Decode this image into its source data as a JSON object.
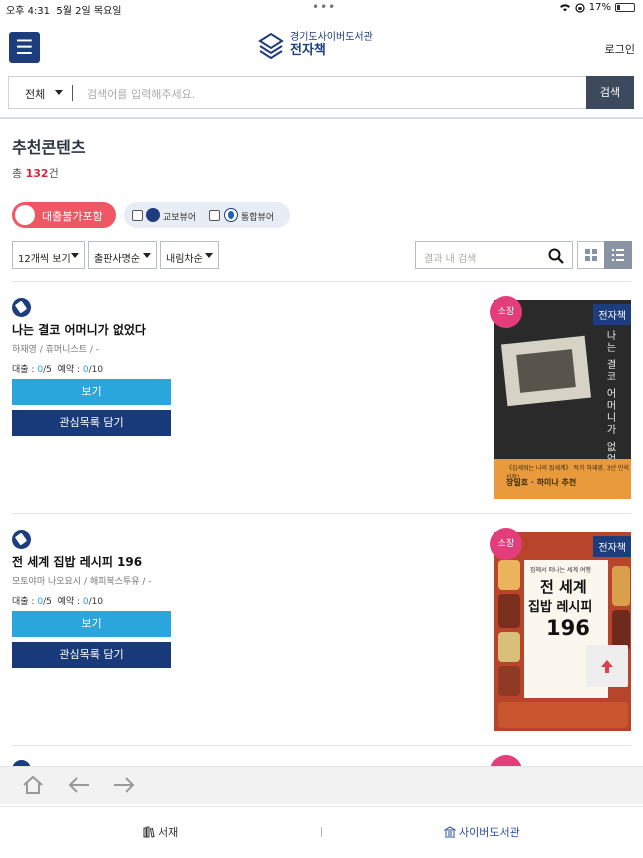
{
  "status": {
    "time": "오후 4:31",
    "date": "5월 2일 목요일",
    "dots": "•••",
    "battery": "17%"
  },
  "header": {
    "logo_line1": "경기도사이버도서관",
    "logo_line2": "전자책",
    "login": "로그인",
    "menu_icon": "☰"
  },
  "search": {
    "scope": "전체",
    "placeholder": "검색어를 입력해주세요.",
    "button": "검색"
  },
  "page": {
    "title": "추천콘텐츠",
    "total_prefix": "총 ",
    "total_count": "132",
    "total_suffix": "건"
  },
  "filters": {
    "toggle_label": "대출불가포함",
    "viewers": [
      {
        "label": "교보뷰어"
      },
      {
        "label": "통합뷰어"
      }
    ],
    "selects": [
      {
        "label": "12개씩 보기"
      },
      {
        "label": "출판사명순"
      },
      {
        "label": "내림차순"
      }
    ],
    "result_search_placeholder": "결과 내 검색"
  },
  "books": [
    {
      "title": "나는 결코 어머니가 없었다",
      "author": "하재영 / 휴머니스트 / -",
      "loan_label": "대출 : ",
      "loan_now": "0",
      "loan_total": "/5",
      "reserve_label": "예약 : ",
      "reserve_now": "0",
      "reserve_total": "/10",
      "view_button": "보기",
      "wish_button": "관심목록 담기",
      "own_badge": "소장",
      "type_tag": "전자책",
      "cover_title": "나는 결코 어머니가 없었다",
      "cover_tagline": "《김세워는 나의 집세계》 작가 하재영, 3년 만의 신작!",
      "cover_blurb": "장일호 · 하미나 추천"
    },
    {
      "title": "전 세계 집밥 레시피 196",
      "author": "모토야마 나오요시 / 해피북스투유 / -",
      "loan_label": "대출 : ",
      "loan_now": "0",
      "loan_total": "/5",
      "reserve_label": "예약 : ",
      "reserve_now": "0",
      "reserve_total": "/10",
      "view_button": "보기",
      "wish_button": "관심목록 담기",
      "own_badge": "소장",
      "type_tag": "전자책",
      "cover_kicker": "집에서 떠나는 세계 여행",
      "cover_t1": "전 세계",
      "cover_t2": "집밥 레시피",
      "cover_t3": "196"
    }
  ],
  "bottom_tabs": {
    "shelf": "서재",
    "library": "사이버도서관"
  },
  "colors": {
    "navy": "#1d3d7c",
    "accent_red": "#d6273d",
    "view_blue": "#2aa6dc",
    "own_pink": "#e33d7b"
  }
}
